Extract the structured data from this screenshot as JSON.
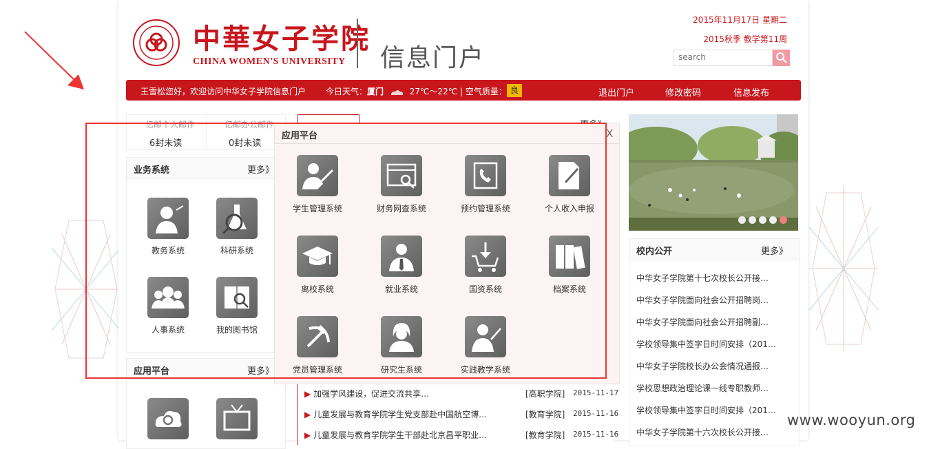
{
  "header": {
    "logo_cn": "中華女子学院",
    "logo_en": "CHINA WOMEN'S UNIVERSITY",
    "portal_title": "信息门户",
    "date": "2015年11月17日 星期二",
    "week": "2015秋季 教学第11周",
    "search_placeholder": "search"
  },
  "navbar": {
    "welcome": "王雪松您好，欢迎访问中华女子学院信息门户",
    "weather_label": "今日天气：",
    "city": "厦门",
    "temperature": "27℃～22℃",
    "aq_label": "空气质量：",
    "aq_value": "良",
    "links": [
      "退出门户",
      "修改密码",
      "信息发布"
    ]
  },
  "mail": {
    "personal_label": "亿邮个人邮件",
    "personal_count": "6封未读",
    "office_label": "亿邮办公邮件",
    "office_count": "0封未读"
  },
  "business": {
    "title": "业务系统",
    "more": "更多》",
    "items": [
      {
        "label": "教务系统",
        "icon": "teacher-icon"
      },
      {
        "label": "科研系统",
        "icon": "flask-magnifier-icon"
      },
      {
        "label": "人事系统",
        "icon": "people-group-icon"
      },
      {
        "label": "我的图书馆",
        "icon": "book-search-icon"
      }
    ]
  },
  "app_left": {
    "title": "应用平台",
    "more": "更多》",
    "items": [
      {
        "icon": "cloud-sync-icon"
      },
      {
        "icon": "tv-icon"
      }
    ]
  },
  "center_tab": {
    "more": "更多》"
  },
  "overlay": {
    "title": "应用平台",
    "close": "X",
    "items": [
      {
        "label": "学生管理系统",
        "icon": "student-writing-icon"
      },
      {
        "label": "财务网查系统",
        "icon": "browser-search-icon"
      },
      {
        "label": "预约管理系统",
        "icon": "phone-note-icon"
      },
      {
        "label": "个人收入申报",
        "icon": "document-edit-icon"
      },
      {
        "label": "离校系统",
        "icon": "graduation-cap-icon"
      },
      {
        "label": "就业系统",
        "icon": "businessman-icon"
      },
      {
        "label": "国资系统",
        "icon": "cart-download-icon"
      },
      {
        "label": "档案系统",
        "icon": "binders-icon"
      },
      {
        "label": "党员管理系统",
        "icon": "hammer-sickle-icon"
      },
      {
        "label": "研究生系统",
        "icon": "female-student-icon"
      },
      {
        "label": "实践教学系统",
        "icon": "teacher-pointer-icon"
      }
    ]
  },
  "news": [
    {
      "title": "加强学风建设，促进交流共享…",
      "dept": "[高职学院]",
      "date": "2015-11-17"
    },
    {
      "title": "儿童发展与教育学院学生党支部赴中国航空博…",
      "dept": "[教育学院]",
      "date": "2015-11-16"
    },
    {
      "title": "儿童发展与教育学院学生干部赴北京昌平职业…",
      "dept": "[教育学院]",
      "date": "2015-11-16"
    }
  ],
  "campus": {
    "slides": 5,
    "active_slide": 5
  },
  "public": {
    "title": "校内公开",
    "more": "更多》",
    "items": [
      "中华女子学院第十七次校长公开接…",
      "中华女子学院面向社会公开招聘岗…",
      "中华女子学院面向社会公开招聘副…",
      "学校领导集中签字日时间安排（201…",
      "中华女子学院校长办公会情况通报…",
      "学校思想政治理论课一线专职教师…",
      "学校领导集中签字日时间安排（201…",
      "中华女子学院第十六次校长公开接…"
    ]
  },
  "watermark": "www.wooyun.org",
  "colors": {
    "brand_red": "#c8161d",
    "icon_grey": "#6e6e6e",
    "highlight_box": "#e33333",
    "aq_badge": "#f5b800"
  }
}
